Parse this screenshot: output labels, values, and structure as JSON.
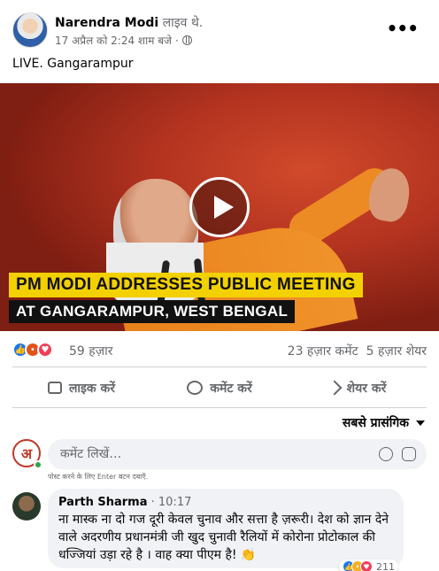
{
  "post": {
    "author": "Narendra Modi",
    "status": "लाइव थे.",
    "timestamp": "17 अप्रैल को 2:24 शाम बजे",
    "separator": "·",
    "caption": "LIVE. Gangarampur",
    "more_icon": "ellipsis-icon"
  },
  "video": {
    "banner_line1": "PM MODI ADDRESSES PUBLIC MEETING",
    "banner_line2": "AT GANGARAMPUR, WEST BENGAL",
    "play_icon": "play-icon"
  },
  "stats": {
    "reaction_count": "59 हज़ार",
    "comments": "23 हज़ार कमेंट",
    "shares": "5 हज़ार शेयर",
    "reaction_icons": [
      "like-icon",
      "angry-icon",
      "love-icon"
    ]
  },
  "actions": {
    "like": "लाइक करें",
    "comment": "कमेंट करें",
    "share": "शेयर करें"
  },
  "sort": {
    "label": "सबसे प्रासंगिक"
  },
  "composer": {
    "placeholder": "कमेंट लिखें…",
    "hint": "पोस्ट करने के लिए Enter बटन दबाएँ.",
    "avatar_letter": "अ"
  },
  "comment": {
    "author": "Parth Sharma",
    "time": "10:17",
    "text": "ना मास्क ना दो गज दूरी केवल चुनाव और सत्ता है ज़रूरी। देश को ज्ञान देने वाले अदरणीय प्रधानमंत्री जी खुद चुनावी रैलियों में कोरोना प्रोटोकाल की धज्जियां उड़ा रहे है । वाह क्या पीएम है! 👏",
    "reaction_count": "211"
  },
  "colors": {
    "accent": "#1877f2",
    "banner_yellow": "#f3d100",
    "text_secondary": "#65676b",
    "bubble_bg": "#f0f2f5"
  }
}
